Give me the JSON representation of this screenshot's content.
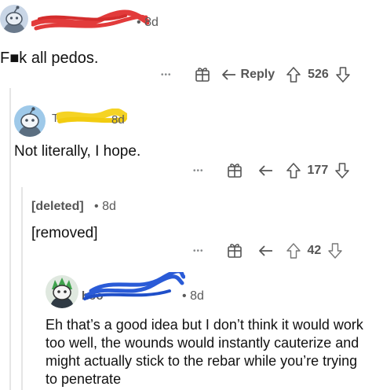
{
  "comments": [
    {
      "author": "",
      "time": "8d",
      "body": "F■k all pedos.",
      "actions": {
        "more": "•••",
        "reply_label": "Reply",
        "upvotes": "526"
      },
      "colors": {
        "avatar_bg": "#c9d6e6",
        "redaction": "#e23b3b"
      }
    },
    {
      "author": "Te",
      "time": "8d",
      "body": "Not literally, I hope.",
      "actions": {
        "more": "•••",
        "reply_label": "",
        "upvotes": "177"
      },
      "colors": {
        "avatar_bg": "#9ec9e9",
        "redaction": "#f5d324"
      }
    },
    {
      "author": "[deleted]",
      "time": "8d",
      "body": "[removed]",
      "actions": {
        "more": "•••",
        "reply_label": "",
        "upvotes": "42"
      }
    },
    {
      "author": "hoo",
      "time": "8d",
      "body": "Eh that’s a good idea but I don’t think it would work too well, the wounds would instantly cauterize and might actually stick to the rebar while you’re trying to penetrate",
      "colors": {
        "avatar_bg": "#dfe8df",
        "redaction": "#2a5bd7"
      }
    }
  ],
  "separator": "•",
  "icons": [
    "user-avatar-icon",
    "award-icon",
    "reply-arrow-icon",
    "upvote-icon",
    "downvote-icon"
  ]
}
